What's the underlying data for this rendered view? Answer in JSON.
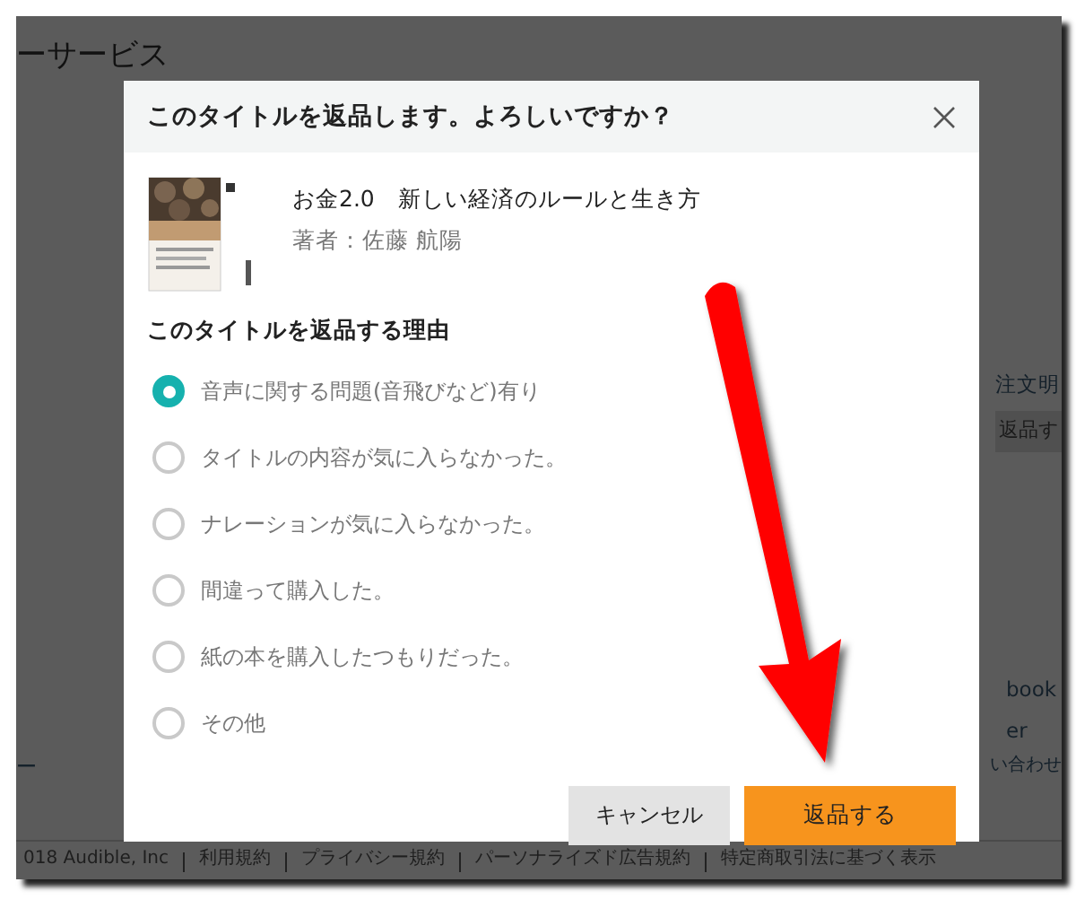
{
  "background": {
    "heading": "ーサービス",
    "order_link": "注文明",
    "return_button": "返品す",
    "side_links": [
      "book",
      "er"
    ],
    "left_text": "ー",
    "contact_link": "い合わせ",
    "footer": [
      "018 Audible, Inc",
      "利用規約",
      "プライバシー規約",
      "パーソナライズド広告規約",
      "特定商取引法に基づく表示"
    ]
  },
  "dialog": {
    "title": "このタイトルを返品します。よろしいですか？",
    "book": {
      "title": "お金2.0　新しい経済のルールと生き方",
      "author": "著者：佐藤 航陽"
    },
    "reasons_heading": "このタイトルを返品する理由",
    "reasons": [
      {
        "label": "音声に関する問題(音飛びなど)有り",
        "selected": true
      },
      {
        "label": "タイトルの内容が気に入らなかった。",
        "selected": false
      },
      {
        "label": "ナレーションが気に入らなかった。",
        "selected": false
      },
      {
        "label": "間違って購入した。",
        "selected": false
      },
      {
        "label": "紙の本を購入したつもりだった。",
        "selected": false
      },
      {
        "label": "その他",
        "selected": false
      }
    ],
    "buttons": [
      {
        "label": "キャンセル",
        "kind": "secondary"
      },
      {
        "label": "返品する",
        "kind": "primary"
      }
    ]
  }
}
